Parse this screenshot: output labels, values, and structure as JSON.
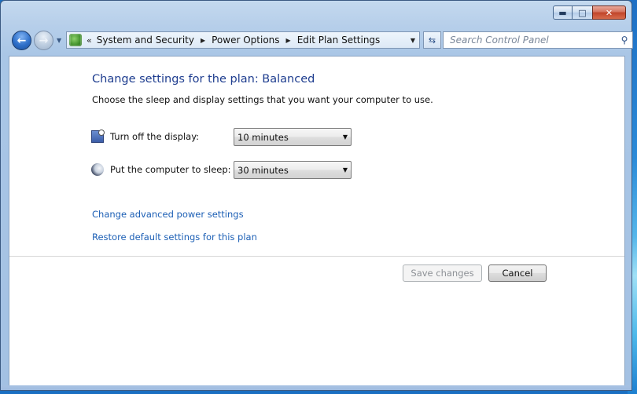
{
  "window": {
    "minimize_glyph": "▬",
    "maximize_glyph": "□",
    "close_glyph": "✕"
  },
  "nav": {
    "back_glyph": "←",
    "forward_glyph": "→",
    "dropdown_glyph": "▼"
  },
  "address": {
    "overflow_glyph": "«",
    "breadcrumbs": [
      "System and Security",
      "Power Options",
      "Edit Plan Settings"
    ],
    "separator_glyph": "▶",
    "dropdown_glyph": "▼",
    "refresh_glyph": "⇆"
  },
  "search": {
    "placeholder": "Search Control Panel",
    "icon_glyph": "⚲"
  },
  "main": {
    "title": "Change settings for the plan: Balanced",
    "subtitle": "Choose the sleep and display settings that you want your computer to use.",
    "settings": [
      {
        "label": "Turn off the display:",
        "value": "10 minutes",
        "icon": "display-icon"
      },
      {
        "label": "Put the computer to sleep:",
        "value": "30 minutes",
        "icon": "sleep-icon"
      }
    ],
    "dropdown_glyph": "▼",
    "links": {
      "advanced": "Change advanced power settings",
      "restore": "Restore default settings for this plan"
    },
    "buttons": {
      "save": "Save changes",
      "cancel": "Cancel"
    }
  },
  "colors": {
    "title": "#1e3d8f",
    "link": "#1c5fb5",
    "window_frame": "#b7cfea"
  }
}
